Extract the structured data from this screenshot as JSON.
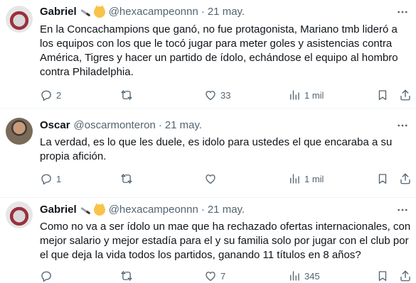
{
  "tweets": [
    {
      "name": "Gabriel",
      "handle": "@hexacampeonnn",
      "separator": "·",
      "date": "21 may.",
      "text": "En la Concachampions que ganó, no fue protagonista, Mariano tmb lideró a los equipos con los que le tocó jugar para meter goles y asistencias contra América, Tigres y hacer un partido de ídolo, echándose el equipo al hombro contra Philadelphia.",
      "replies": "2",
      "retweets": "",
      "likes": "33",
      "views": "1 mil"
    },
    {
      "name": "Oscar",
      "handle": "@oscarmonteron",
      "separator": "·",
      "date": "21 may.",
      "text": "La verdad, es lo que les duele, es idolo para ustedes el que encaraba a su propia afición.",
      "replies": "1",
      "retweets": "",
      "likes": "",
      "views": "1 mil"
    },
    {
      "name": "Gabriel",
      "handle": "@hexacampeonnn",
      "separator": "·",
      "date": "21 may.",
      "text": "Como no va a ser ídolo un mae que ha rechazado ofertas internacionales, con mejor salario y mejor estadía para el y su familia solo por jugar con el club por el que deja la vida todos los partidos, ganando 11 títulos en 8 años?",
      "replies": "",
      "retweets": "",
      "likes": "7",
      "views": "345"
    }
  ],
  "icons": {
    "reply": "reply-icon",
    "retweet": "retweet-icon",
    "like": "heart-icon",
    "views": "views-icon",
    "bookmark": "bookmark-icon",
    "share": "share-icon",
    "more": "more-icon"
  },
  "colors": {
    "text": "#0f1419",
    "secondary": "#536471",
    "divider": "#eff3f4"
  }
}
